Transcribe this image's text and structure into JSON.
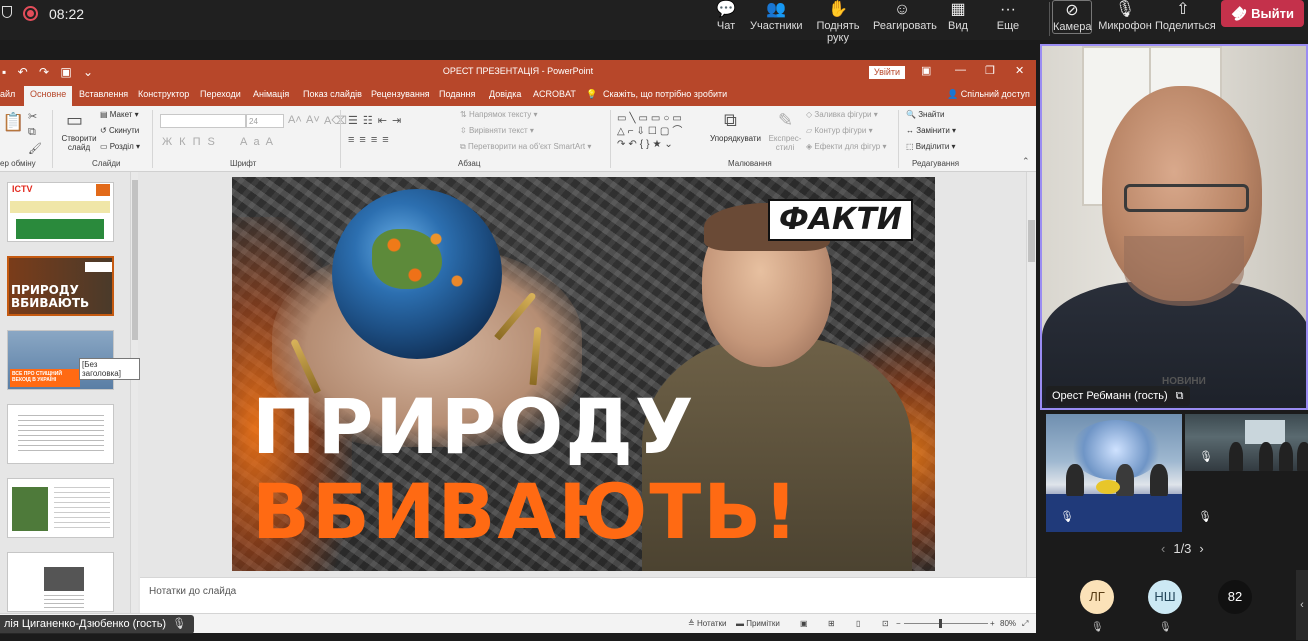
{
  "topbar": {
    "timer": "08:22",
    "buttons": [
      {
        "icon": "chat-icon",
        "glyph": "💬",
        "label": "Чат"
      },
      {
        "icon": "participants-icon",
        "glyph": "👥",
        "label": "Участники"
      },
      {
        "icon": "raise-hand-icon",
        "glyph": "✋",
        "label": "Поднять руку"
      },
      {
        "icon": "react-icon",
        "glyph": "☺",
        "label": "Реагировать"
      },
      {
        "icon": "view-icon",
        "glyph": "▦",
        "label": "Вид"
      },
      {
        "icon": "more-icon",
        "glyph": "···",
        "label": "Еще"
      },
      {
        "icon": "camera-off-icon",
        "glyph": "⊘",
        "label": "Камера"
      },
      {
        "icon": "mic-off-icon",
        "glyph": "🎙",
        "label": "Микрофон"
      },
      {
        "icon": "share-icon",
        "glyph": "⇧",
        "label": "Поделиться"
      }
    ],
    "leave_label": "Выйти",
    "record_color": "#e34d5a",
    "leave_color": "#c4314b"
  },
  "powerpoint": {
    "accent_color": "#b7472a",
    "title": "ОРЕСТ ПРЕЗЕНТАЦІЯ  -  PowerPoint",
    "signin": "Увійти",
    "tabs": [
      "айл",
      "Основне",
      "Вставлення",
      "Конструктор",
      "Переходи",
      "Анімація",
      "Показ слайдів",
      "Рецензування",
      "Подання",
      "Довідка",
      "ACROBAT"
    ],
    "active_tab": "Основне",
    "tell_me": "Скажіть, що потрібно зробити",
    "share": "Спільний доступ",
    "ribbon": {
      "clipboard_label": "ер обміну",
      "new_slide": "Створити слайд",
      "layout": "Макет",
      "reset": "Скинути",
      "section": "Розділ",
      "slides_label": "Слайди",
      "font_size": "24",
      "font_label": "Шрифт",
      "text_direction": "Напрямок тексту",
      "align_text": "Вирівняти текст",
      "smartart": "Перетворити на об'єкт SmartArt",
      "paragraph_label": "Абзац",
      "arrange": "Упорядкувати",
      "quick_styles": "Експрес-стилі",
      "shape_fill": "Заливка фігури",
      "shape_outline": "Контур фігури",
      "shape_effects": "Ефекти для фігур",
      "drawing_label": "Малювання",
      "find": "Знайти",
      "replace": "Замінити",
      "select": "Виділити",
      "editing_label": "Редагування"
    },
    "thumbnails": [
      {
        "name": "thumb-slide-1",
        "text": "ICTV"
      },
      {
        "name": "thumb-slide-2",
        "text": "ПРИРОДУ ВБИВАЮТЬ"
      },
      {
        "name": "thumb-slide-3",
        "text": "ВСЕ ПРО СТИЩНИЙ ВЕКОІД В УКРАЇНІ"
      },
      {
        "name": "thumb-slide-4",
        "text": ""
      },
      {
        "name": "thumb-slide-5",
        "text": ""
      },
      {
        "name": "thumb-slide-6",
        "text": ""
      }
    ],
    "tooltip": "Без заголовка",
    "slide": {
      "logo": "ФАКТИ",
      "line1": "ПРИРОДУ",
      "line2": "ВБИВАЮТЬ!",
      "orange": "#ff6a13"
    },
    "notes_placeholder": "Нотатки до слайда",
    "status": {
      "notes": "Нотатки",
      "comments": "Примітки",
      "zoom": "80%"
    }
  },
  "presenter_name": "лія Циганенко-Дзюбенко (гость)",
  "main_video": {
    "name": "Орест Ребманн (гость)",
    "hoodie_text": "НОВИНИ",
    "border_color": "#9a8cf2"
  },
  "pager": {
    "text": "1/3"
  },
  "avatars": [
    {
      "initials": "ЛГ"
    },
    {
      "initials": "НШ"
    },
    {
      "initials": "82"
    }
  ]
}
